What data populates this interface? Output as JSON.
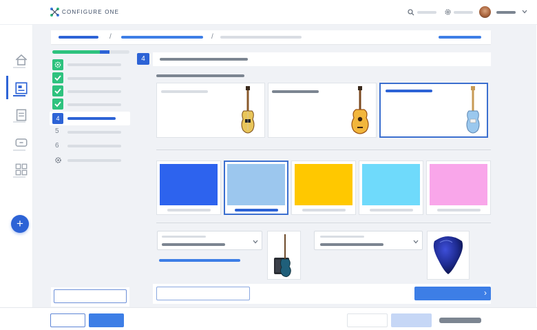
{
  "app": {
    "logo_text": "CONFIGURE ONE",
    "breadcrumb_separator_1": "/",
    "breadcrumb_separator_2": "/"
  },
  "steps": [
    {
      "status": "done-gear",
      "label": ""
    },
    {
      "status": "done",
      "label": ""
    },
    {
      "status": "done",
      "label": ""
    },
    {
      "status": "done",
      "label": ""
    },
    {
      "status": "active",
      "number": "4"
    },
    {
      "status": "pending",
      "number": "5"
    },
    {
      "status": "pending",
      "number": "6"
    },
    {
      "status": "settings-gear"
    }
  ],
  "progress": {
    "green_fraction": 0.62,
    "blue_fraction": 0.12
  },
  "section_badge": "4",
  "guitars": [
    {
      "image": "electric-guitar-sunburst",
      "selected": false
    },
    {
      "image": "acoustic-guitar-sunburst",
      "selected": false
    },
    {
      "image": "electric-guitar-blue",
      "selected": true
    }
  ],
  "swatches": [
    {
      "color": "#2d63ee",
      "selected": false
    },
    {
      "color": "#9cc7ee",
      "selected": true
    },
    {
      "color": "#ffc800",
      "selected": false
    },
    {
      "color": "#6fdafb",
      "selected": false
    },
    {
      "color": "#f9a6ea",
      "selected": false
    }
  ],
  "accessories": [
    {
      "image": "amp-with-guitar"
    },
    {
      "image": "blue-guitar-pick"
    }
  ],
  "next_glyph": "›",
  "fab_glyph": "+",
  "colors": {
    "accent": "#2d63d6",
    "success": "#2ec27e",
    "canvas": "#f0f2f6"
  }
}
